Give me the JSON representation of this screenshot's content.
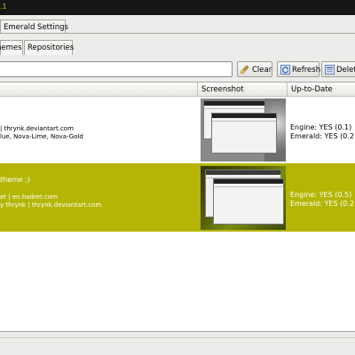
{
  "window": {
    "title": ".1"
  },
  "tabs": {
    "main": "Emerald Settings"
  },
  "subtabs": {
    "themes": "hemes",
    "repositories": "Repositories"
  },
  "search": {
    "value": ""
  },
  "toolbar": {
    "clear_label": "Clear",
    "refresh_label": "Refresh",
    "delete_label": "Delete"
  },
  "columns": {
    "name": "",
    "screenshot": "Screenshot",
    "uptodate": "Up-to-Date"
  },
  "rows": [
    {
      "line1": "| thrynk.deviantart.com",
      "line2": "lue, Nova-Lime, Nova-Gold",
      "engine": "Engine: YES (0.1)",
      "emerald": "Emerald: YES (0.2"
    },
    {
      "title": "theme ;)",
      "line1": "et | en.hadret.com",
      "line2": "y thrynk | thrynk.deviantart.com",
      "engine": "Engine: YES (0.5)",
      "emerald": "Emerald: YES (0.2"
    }
  ],
  "colors": {
    "accent": "#b5b506",
    "titlebar": "#161616",
    "title_text": "#bccb1a"
  },
  "icons": {
    "clear": "broom-icon",
    "refresh": "refresh-icon",
    "delete": "delete-icon"
  }
}
